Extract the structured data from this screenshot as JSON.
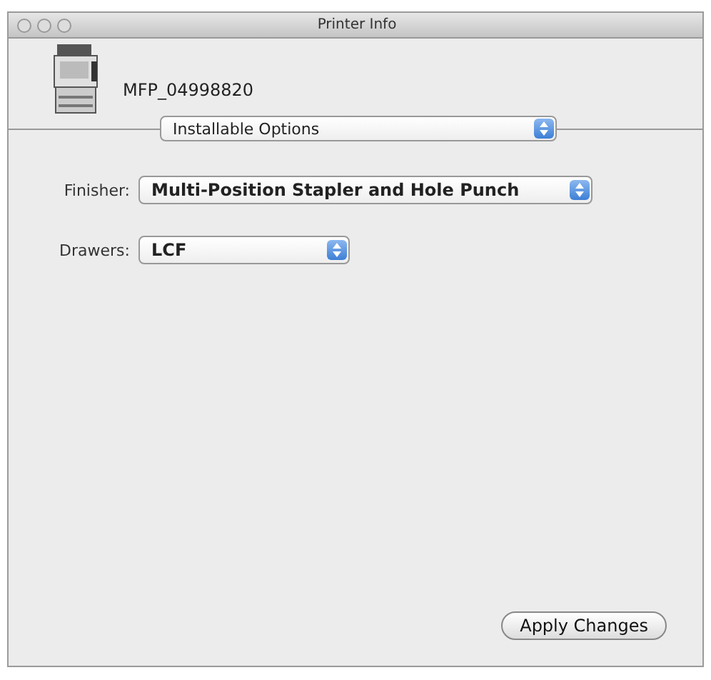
{
  "window": {
    "title": "Printer Info"
  },
  "printer": {
    "name": "MFP_04998820"
  },
  "panel_popup": {
    "value": "Installable Options"
  },
  "options": [
    {
      "label": "Finisher:",
      "value": "Multi-Position Stapler and Hole Punch"
    },
    {
      "label": "Drawers:",
      "value": "LCF"
    }
  ],
  "buttons": [
    {
      "label": "Apply Changes"
    }
  ]
}
